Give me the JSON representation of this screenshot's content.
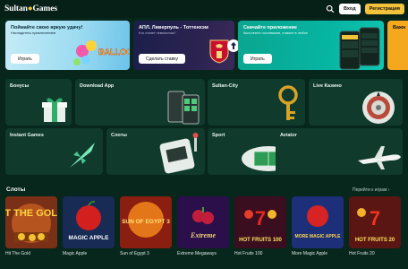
{
  "header": {
    "logo_main": "Sultan",
    "logo_sub": "Games",
    "login_label": "Вход",
    "register_label": "Регистрация"
  },
  "banners": [
    {
      "title": "Поймайте свою яркую удачу!",
      "subtitle": "Насладитесь приключением",
      "button": "Играть",
      "art_text": "BALLOON"
    },
    {
      "title": "АПЛ. Ливерпуль - Тоттенхэм",
      "subtitle": "Кто станет чемпионом?",
      "button": "Сделать ставку"
    },
    {
      "title": "Скачайте приложение",
      "subtitle": "Выполните поставками, ставьте в любое",
      "button": "Играть"
    },
    {
      "title": "Важн"
    }
  ],
  "categories": [
    "Бонусы",
    "Download App",
    "Sultan-City",
    "Live Казино",
    "Instant Games",
    "Слоты",
    "Sport",
    "Aviator"
  ],
  "slots": {
    "title": "Слоты",
    "more_label": "Перейти к играм",
    "games": [
      {
        "name": "Hit The Gold",
        "art": "HIT THE GOLD!"
      },
      {
        "name": "Magic Apple",
        "art": "MAGIC APPLE"
      },
      {
        "name": "Sun of Egypt 3",
        "art": "SUN OF EGYPT 3"
      },
      {
        "name": "Extreme Megaways",
        "art": "Extreme"
      },
      {
        "name": "Hot Fruits 100",
        "art": "HOT FRUITS 100"
      },
      {
        "name": "More Magic Apple",
        "art": "MORE MAGIC APPLE"
      },
      {
        "name": "Hot Fruits 20",
        "art": "HOT FRUITS 20"
      }
    ]
  },
  "colors": {
    "background": "#07261c",
    "tile": "#0f3a2c",
    "accent": "#f4c23a"
  }
}
